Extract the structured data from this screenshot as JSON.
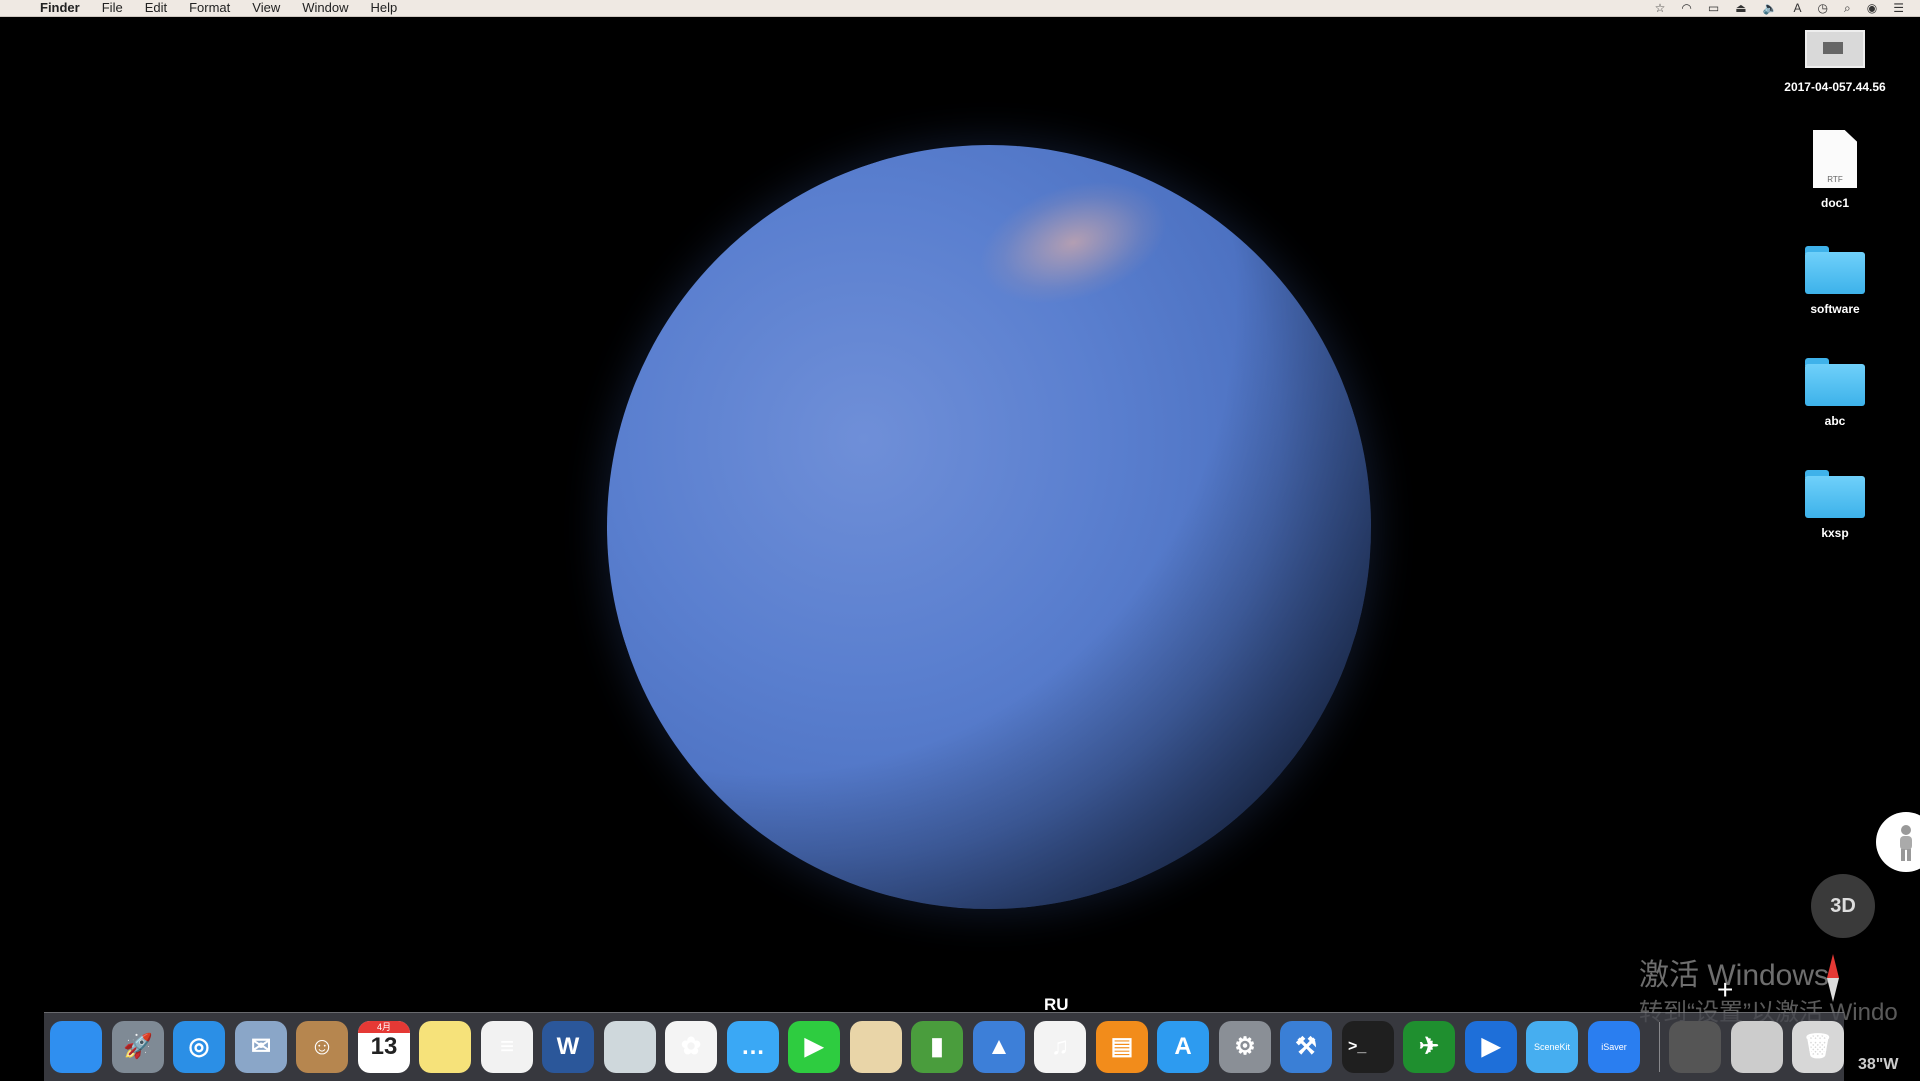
{
  "menubar": {
    "app_name": "Finder",
    "items": [
      "File",
      "Edit",
      "Format",
      "View",
      "Window",
      "Help"
    ],
    "status_icons": [
      "star-icon",
      "wifi-icon",
      "airplay-icon",
      "eject-icon",
      "volume-icon",
      "input-source-icon",
      "clock-icon",
      "spotlight-icon",
      "siri-icon",
      "notification-center-icon"
    ],
    "input_source_label": "A"
  },
  "desktop": {
    "items": [
      {
        "label": "2017-04-057.44.56",
        "type": "screenshot"
      },
      {
        "label": "doc1",
        "type": "rtf",
        "badge": "RTF"
      },
      {
        "label": "software",
        "type": "folder"
      },
      {
        "label": "abc",
        "type": "folder"
      },
      {
        "label": "kxsp",
        "type": "folder"
      }
    ]
  },
  "map": {
    "view_mode_button": "3D",
    "place_label": "RU",
    "coordinate_text": "38\"W",
    "zoom_in": "+"
  },
  "watermark": {
    "line1": "激活 Windows",
    "line2": "转到“设置”以激活 Windo"
  },
  "dock": {
    "apps": [
      {
        "name": "finder",
        "color": "#2f8ff0",
        "glyph": ""
      },
      {
        "name": "launchpad",
        "color": "#7f8a95",
        "glyph": "🚀"
      },
      {
        "name": "safari",
        "color": "#2b8fe6",
        "glyph": "◎"
      },
      {
        "name": "mail",
        "color": "#8aa6c8",
        "glyph": "✉"
      },
      {
        "name": "contacts",
        "color": "#b6864f",
        "glyph": "☺"
      },
      {
        "name": "calendar",
        "color": "#ffffff",
        "glyph": "13"
      },
      {
        "name": "notes",
        "color": "#f6e27a",
        "glyph": ""
      },
      {
        "name": "reminders",
        "color": "#f2f2f2",
        "glyph": "≡"
      },
      {
        "name": "word",
        "color": "#2b579a",
        "glyph": "W"
      },
      {
        "name": "preview",
        "color": "#cfd8dc",
        "glyph": ""
      },
      {
        "name": "photos",
        "color": "#f4f4f4",
        "glyph": "✿"
      },
      {
        "name": "messages",
        "color": "#3aa8f5",
        "glyph": "…"
      },
      {
        "name": "facetime",
        "color": "#2ecc40",
        "glyph": "▶"
      },
      {
        "name": "textedit",
        "color": "#e9d5a8",
        "glyph": ""
      },
      {
        "name": "numbers",
        "color": "#4a9d3d",
        "glyph": "▮"
      },
      {
        "name": "keynote",
        "color": "#3d7fd8",
        "glyph": "▲"
      },
      {
        "name": "itunes",
        "color": "#f3f3f3",
        "glyph": "♫"
      },
      {
        "name": "ibooks",
        "color": "#f28c1b",
        "glyph": "▤"
      },
      {
        "name": "app-store",
        "color": "#2d9bf0",
        "glyph": "A"
      },
      {
        "name": "system-preferences",
        "color": "#8a8f96",
        "glyph": "⚙"
      },
      {
        "name": "xcode",
        "color": "#3a7fd6",
        "glyph": "⚒"
      },
      {
        "name": "terminal",
        "color": "#1f1f1f",
        "glyph": ">_"
      },
      {
        "name": "maps-app",
        "color": "#1f8f2f",
        "glyph": "✈"
      },
      {
        "name": "keynote-remote",
        "color": "#1e6fd9",
        "glyph": "▶"
      },
      {
        "name": "scenekit-wwdc13",
        "color": "#46aef0",
        "glyph": "SceneKit"
      },
      {
        "name": "isaver",
        "color": "#2a7ef0",
        "glyph": "iSaver"
      },
      {
        "name": "document-stack",
        "color": "#555555",
        "glyph": ""
      },
      {
        "name": "screen-recording",
        "color": "#cccccc",
        "glyph": ""
      },
      {
        "name": "trash",
        "color": "#d7d7d7",
        "glyph": "🗑"
      }
    ],
    "calendar_month": "4月",
    "calendar_day": "13"
  }
}
